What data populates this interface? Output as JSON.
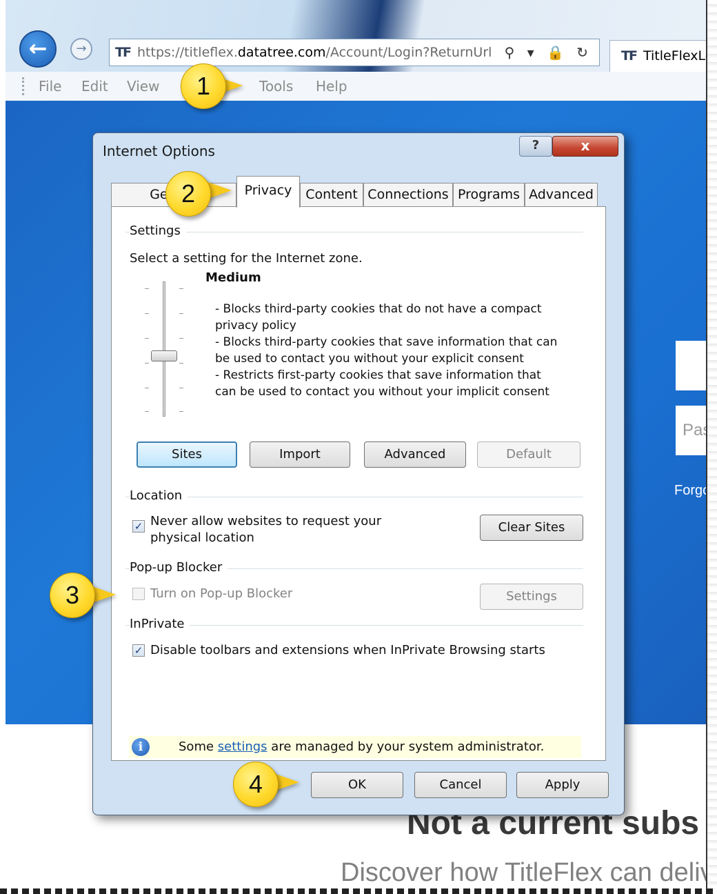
{
  "browser": {
    "address": {
      "prefix": "https://",
      "host_sub": "titleflex.",
      "host": "datatree.com",
      "path": "/Account/Login?ReturnUrl",
      "logo": "TF",
      "icons": "⚲ ▾ 🔒 ↻"
    },
    "tab": {
      "logo": "TF",
      "title": "TitleFlexLog"
    },
    "back_icon": "arrow-left-icon",
    "forward_icon": "arrow-right-icon",
    "menu": [
      "File",
      "Edit",
      "View",
      "Tools",
      "Help"
    ]
  },
  "page": {
    "password_placeholder": "Pas",
    "forgot_link": "Forgo",
    "heading": "Not a current subs",
    "subheading": "Discover how TitleFlex can deliv"
  },
  "dialog": {
    "title": "Internet Options",
    "help_label": "?",
    "close_label": "x",
    "tabs": [
      "Genera",
      "Privacy",
      "Content",
      "Connections",
      "Programs",
      "Advanced"
    ],
    "active_tab": "Privacy",
    "settings": {
      "group_label": "Settings",
      "prompt": "Select a setting for the Internet zone.",
      "level": "Medium",
      "level_fraction": 0.5,
      "description": "- Blocks third-party cookies that do not have a compact\nprivacy policy\n- Blocks third-party cookies that save information that can\nbe used to contact you without your explicit consent\n- Restricts first-party cookies that save information that\ncan be used to contact you without your implicit consent",
      "buttons": {
        "sites": "Sites",
        "import": "Import",
        "advanced": "Advanced",
        "default": "Default"
      }
    },
    "location": {
      "group_label": "Location",
      "checkbox_label": "Never allow websites to request your\nphysical location",
      "checked": true,
      "clear_sites": "Clear Sites"
    },
    "popup": {
      "group_label": "Pop-up Blocker",
      "checkbox_label": "Turn on Pop-up Blocker",
      "checked": false,
      "settings_button": "Settings"
    },
    "inprivate": {
      "group_label": "InPrivate",
      "checkbox_label": "Disable toolbars and extensions when InPrivate Browsing starts",
      "checked": true
    },
    "info": {
      "before": "Some ",
      "link": "settings",
      "after": " are managed by your system administrator."
    },
    "footer": {
      "ok": "OK",
      "cancel": "Cancel",
      "apply": "Apply"
    }
  },
  "callouts": [
    "1",
    "2",
    "3",
    "4"
  ],
  "colors": {
    "callout": "#ffd92c",
    "page_blue": "#1f78d6",
    "close_button": "#c54530",
    "link": "#1a5fb4"
  }
}
